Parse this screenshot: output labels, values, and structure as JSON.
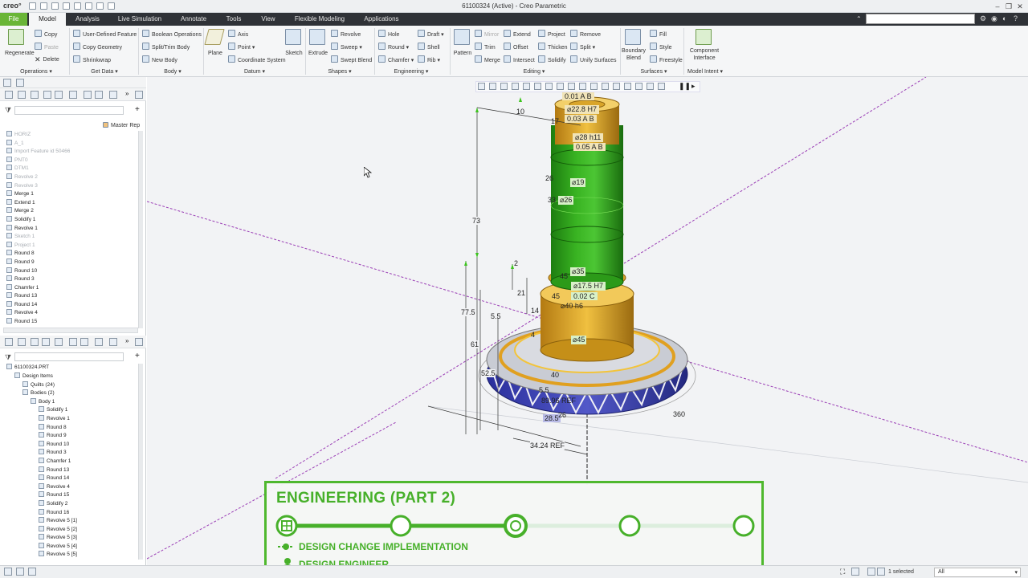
{
  "titlebar": {
    "logo": "creo°",
    "title": "61100324 (Active) - Creo Parametric"
  },
  "tabs": [
    "File",
    "Model",
    "Analysis",
    "Live Simulation",
    "Annotate",
    "Tools",
    "View",
    "Flexible Modeling",
    "Applications"
  ],
  "ribbon": {
    "operations": {
      "regenerate": "Regenerate",
      "copy": "Copy",
      "paste": "Paste",
      "delete": "Delete",
      "group": "Operations"
    },
    "getdata": {
      "udf": "User-Defined Feature",
      "copygeom": "Copy Geometry",
      "shrinkwrap": "Shrinkwrap",
      "group": "Get Data"
    },
    "body": {
      "boolean": "Boolean Operations",
      "split": "Split/Trim Body",
      "newbody": "New Body",
      "group": "Body"
    },
    "datum": {
      "plane": "Plane",
      "axis": "Axis",
      "point": "Point",
      "csys": "Coordinate System",
      "sketch": "Sketch",
      "group": "Datum"
    },
    "shapes": {
      "extrude": "Extrude",
      "revolve": "Revolve",
      "sweep": "Sweep",
      "sweptblend": "Swept Blend",
      "group": "Shapes"
    },
    "engineering": {
      "hole": "Hole",
      "round": "Round",
      "chamfer": "Chamfer",
      "draft": "Draft",
      "shell": "Shell",
      "rib": "Rib",
      "group": "Engineering"
    },
    "editing": {
      "pattern": "Pattern",
      "mirror": "Mirror",
      "trim": "Trim",
      "merge": "Merge",
      "extend": "Extend",
      "offset": "Offset",
      "intersect": "Intersect",
      "project": "Project",
      "thicken": "Thicken",
      "solidify": "Solidify",
      "remove": "Remove",
      "split": "Split",
      "unify": "Unify Surfaces",
      "group": "Editing"
    },
    "surfaces": {
      "boundary": "Boundary Blend",
      "fill": "Fill",
      "style": "Style",
      "freestyle": "Freestyle",
      "group": "Surfaces"
    },
    "intent": {
      "component": "Component Interface",
      "group": "Model Intent"
    }
  },
  "layer_panel": {
    "master_rep": "Master Rep",
    "items": [
      {
        "label": "HORIZ",
        "dim": true
      },
      {
        "label": "A_1",
        "dim": true
      },
      {
        "label": "Import Feature id 50466",
        "dim": true
      },
      {
        "label": "PNT0",
        "dim": true
      },
      {
        "label": "DTM1",
        "dim": true
      },
      {
        "label": "Revolve 2",
        "dim": true
      },
      {
        "label": "Revolve 3",
        "dim": true
      },
      {
        "label": "Merge 1",
        "dim": false
      },
      {
        "label": "Extend 1",
        "dim": false
      },
      {
        "label": "Merge 2",
        "dim": false
      },
      {
        "label": "Solidify 1",
        "dim": false
      },
      {
        "label": "Revolve 1",
        "dim": false
      },
      {
        "label": "Sketch 1",
        "dim": true
      },
      {
        "label": "Project 1",
        "dim": true
      },
      {
        "label": "Round 8",
        "dim": false
      },
      {
        "label": "Round 9",
        "dim": false
      },
      {
        "label": "Round 10",
        "dim": false
      },
      {
        "label": "Round 3",
        "dim": false
      },
      {
        "label": "Chamfer 1",
        "dim": false
      },
      {
        "label": "Round 13",
        "dim": false
      },
      {
        "label": "Round 14",
        "dim": false
      },
      {
        "label": "Revolve 4",
        "dim": false
      },
      {
        "label": "Round 15",
        "dim": false
      }
    ]
  },
  "model_tree": {
    "root": "61100324.PRT",
    "items": [
      {
        "label": "Design Items",
        "indent": 1
      },
      {
        "label": "Quilts (24)",
        "indent": 2
      },
      {
        "label": "Bodies (2)",
        "indent": 2
      },
      {
        "label": "Body 1",
        "indent": 3
      },
      {
        "label": "Solidify 1",
        "indent": 4
      },
      {
        "label": "Revolve 1",
        "indent": 4
      },
      {
        "label": "Round 8",
        "indent": 4
      },
      {
        "label": "Round 9",
        "indent": 4
      },
      {
        "label": "Round 10",
        "indent": 4
      },
      {
        "label": "Round 3",
        "indent": 4
      },
      {
        "label": "Chamfer 1",
        "indent": 4
      },
      {
        "label": "Round 13",
        "indent": 4
      },
      {
        "label": "Round 14",
        "indent": 4
      },
      {
        "label": "Revolve 4",
        "indent": 4
      },
      {
        "label": "Round 15",
        "indent": 4
      },
      {
        "label": "Solidify 2",
        "indent": 4
      },
      {
        "label": "Round 16",
        "indent": 4
      },
      {
        "label": "Revolve 5 [1]",
        "indent": 4
      },
      {
        "label": "Revolve 5 [2]",
        "indent": 4
      },
      {
        "label": "Revolve 5 [3]",
        "indent": 4
      },
      {
        "label": "Revolve 5 [4]",
        "indent": 4
      },
      {
        "label": "Revolve 5 [5]",
        "indent": 4
      }
    ]
  },
  "dims": {
    "d001": "0.01",
    "dA1": "A",
    "dB1": "B",
    "d228": "22.8 H7",
    "d003": "0.03",
    "dA2": "A",
    "dB2": "B",
    "d28h11": "28 h11",
    "d005": "0.05",
    "dA3": "A",
    "dB3": "B",
    "d10": "10",
    "d17": "17",
    "d26": "26",
    "d19": "19",
    "d33": "33",
    "d26b": "26",
    "d73": "73",
    "d2": "2",
    "d45": "45",
    "d35": "35",
    "d175": "17.5 H7",
    "d002": "0.02",
    "dC": "C",
    "d45b": "45",
    "d40h6": "40 h6",
    "d21": "21",
    "d14": "14",
    "d775": "77.5",
    "d55": "5.5",
    "d4": "4",
    "d45c": "45",
    "d61": "61",
    "d525": "52.5",
    "d40": "40",
    "d55b": "5.5",
    "d8996": "89.96  REF",
    "d285": "28.5",
    "d26c": "26",
    "d360": "360",
    "d3424": "34.24  REF"
  },
  "status": {
    "selected": "1 selected",
    "filter": "All"
  },
  "banner": {
    "title": "ENGINEERING (PART 2)",
    "line1": "DESIGN CHANGE IMPLEMENTATION",
    "line2": "DESIGN ENGINEER"
  },
  "colors": {
    "accent": "#4fb82e",
    "tabbar": "#2f3237",
    "model_green": "#2fa51a",
    "gear_orange": "#e0a020",
    "gear_blue": "#3a3fb0"
  }
}
